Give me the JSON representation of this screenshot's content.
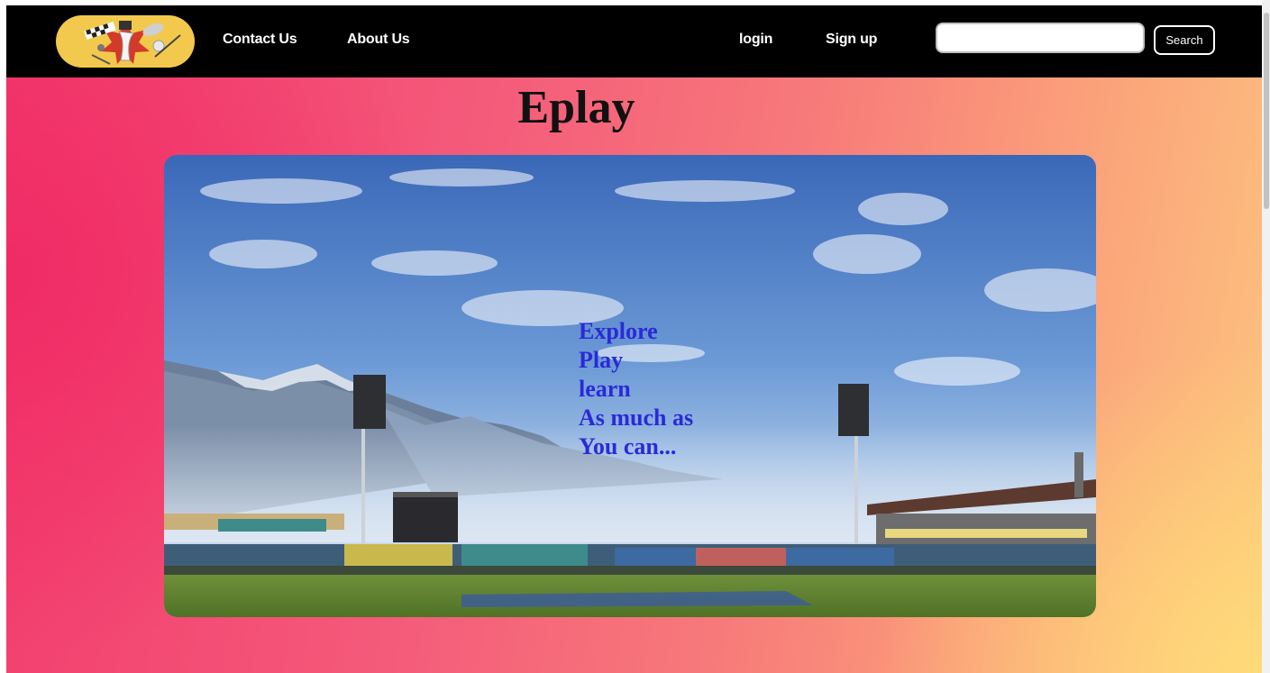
{
  "nav": {
    "logo_icon": "sports-emblem-icon",
    "contact_label": "Contact Us",
    "about_label": "About Us",
    "login_label": "login",
    "signup_label": "Sign up",
    "search": {
      "value": "",
      "placeholder": "",
      "button_label": "Search"
    }
  },
  "main": {
    "title": "Eplay",
    "hero": {
      "image": "cricket-stadium-mountains",
      "tagline": [
        "Explore",
        "Play",
        "learn",
        "As much as",
        "You can..."
      ]
    }
  },
  "colors": {
    "nav_bg": "#000000",
    "logo_bg": "#f2c94c",
    "tagline": "#2a2ad8",
    "gradient_start": "#f23a6c",
    "gradient_end": "#fcc57f"
  }
}
